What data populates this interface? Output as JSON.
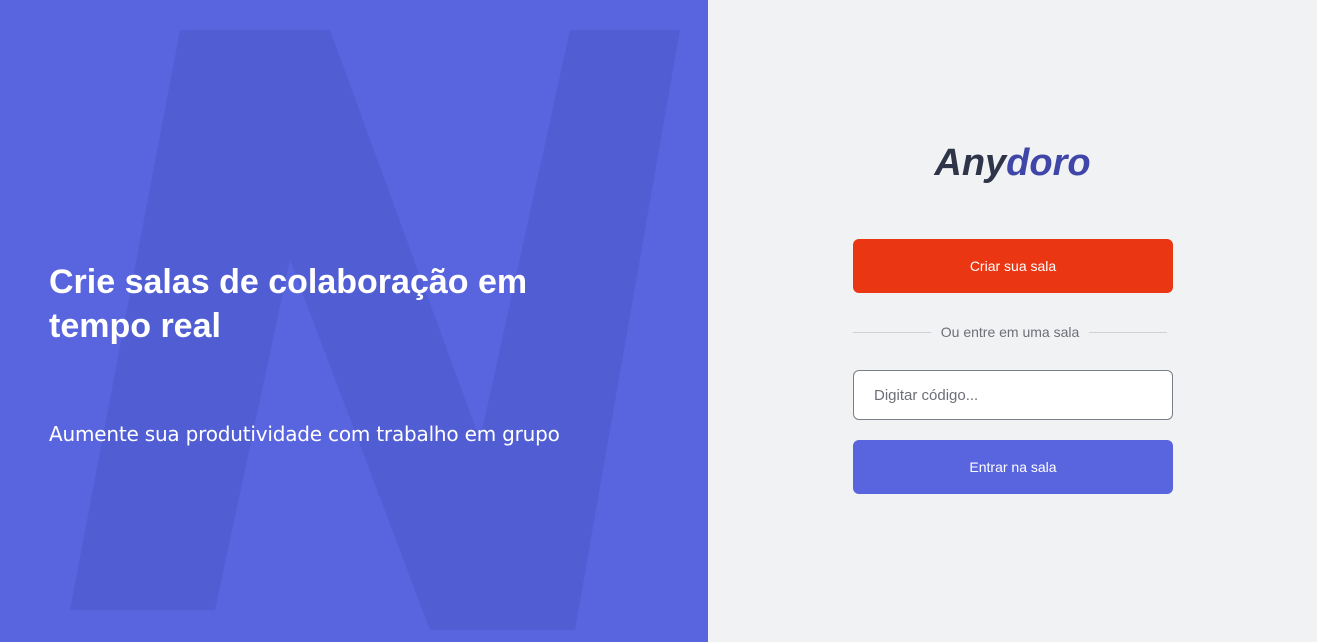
{
  "hero": {
    "title": "Crie salas de colaboração em tempo real",
    "subtitle": "Aumente sua produtividade com trabalho em grupo",
    "background_color": "#5964df",
    "background_icon": "anydoro-n-logo"
  },
  "brand": {
    "part1": "Any",
    "part2": "doro",
    "color_dark": "#2e3548",
    "color_accent": "#3f46a8"
  },
  "actions": {
    "create_room_label": "Criar sua sala",
    "create_room_color": "#ea3612",
    "divider_text": "Ou entre em uma sala",
    "room_code_placeholder": "Digitar código...",
    "room_code_value": "",
    "enter_room_label": "Entrar na sala",
    "enter_room_color": "#5964df"
  }
}
